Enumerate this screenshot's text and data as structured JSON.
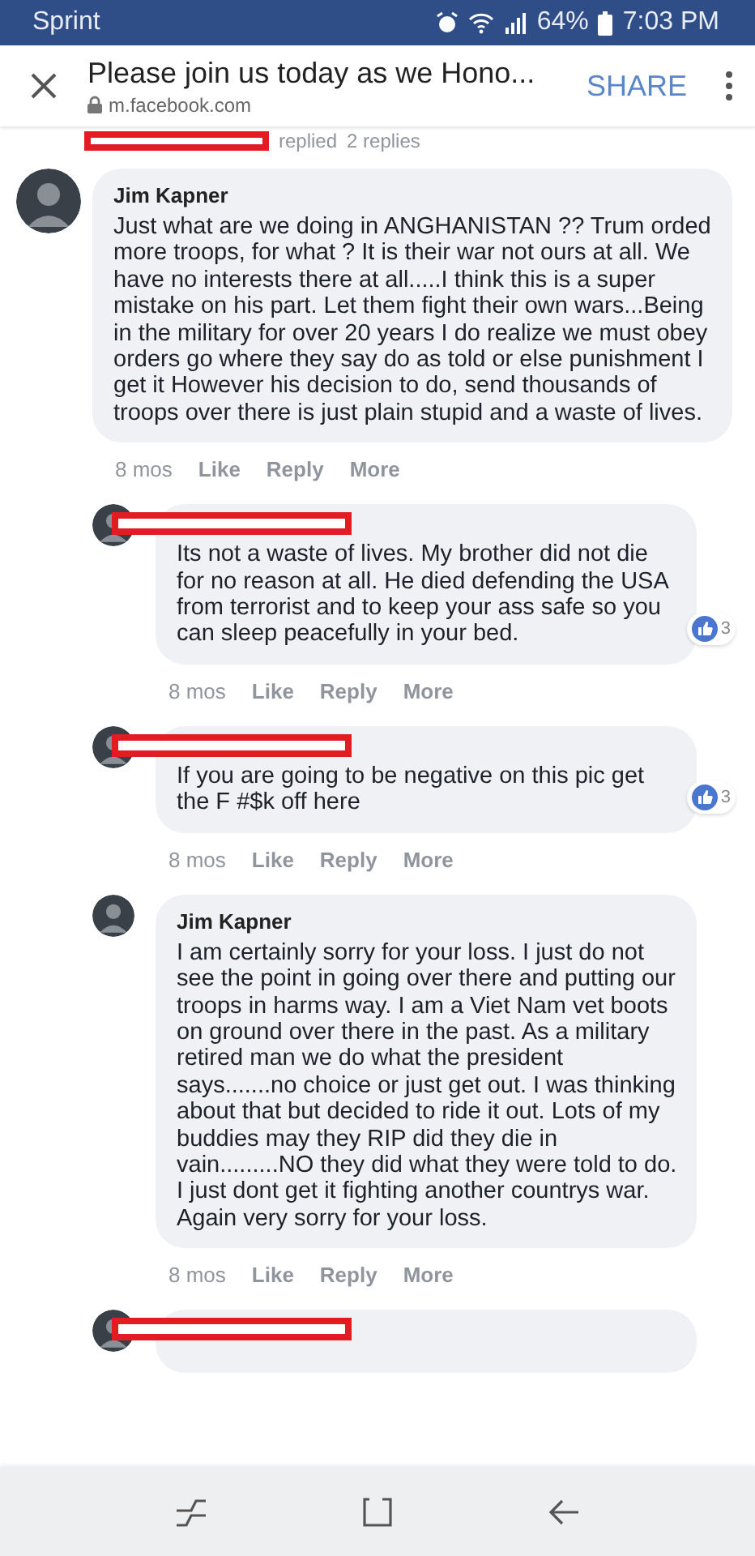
{
  "status_bar": {
    "carrier": "Sprint",
    "battery": "64%",
    "time": "7:03 PM"
  },
  "header": {
    "title": "Please join us today as we Hono...",
    "url": "m.facebook.com",
    "share": "SHARE"
  },
  "replied_row": {
    "redacted": true,
    "action": "replied",
    "count": "2 replies"
  },
  "comments": [
    {
      "author": "Jim Kapner",
      "redacted": false,
      "text": "Just what are we doing in ANGHANISTAN ?? Trum orded more troops, for what ? It is their war not ours at all. We have no interests there at all.....I think this is a super mistake on his part. Let them fight their own wars...Being in the military for over 20 years I do realize we must obey orders go where they say do as told or else punishment I get it However his decision to do, send thousands of troops over there is just plain stupid and a waste of lives.",
      "time": "8 mos",
      "actions": [
        "Like",
        "Reply",
        "More"
      ],
      "children": [
        {
          "redacted": true,
          "text": "Its not a waste of lives. My brother did not die for no reason at all. He died defending the USA from terrorist and to keep your ass safe so you can sleep peacefully in your bed.",
          "likes": "3",
          "time": "8 mos",
          "actions": [
            "Like",
            "Reply",
            "More"
          ]
        },
        {
          "redacted": true,
          "text": "If you are going to be negative on this pic get the F #$k off here",
          "likes": "3",
          "time": "8 mos",
          "actions": [
            "Like",
            "Reply",
            "More"
          ]
        },
        {
          "author": "Jim Kapner",
          "redacted": false,
          "text": "I am certainly sorry for your loss. I just do not see the point in going over there and putting our troops in harms way. I am a Viet Nam vet boots on ground over there in the past. As a military retired man we do what the president says.......no choice or just get out. I was thinking about that but decided to ride it out. Lots of my buddies may they RIP did they die in vain.........NO they did what they were told to do. I just dont get it fighting another countrys war. Again very sorry for your loss.",
          "time": "8 mos",
          "actions": [
            "Like",
            "Reply",
            "More"
          ]
        },
        {
          "redacted": true
        }
      ]
    }
  ]
}
